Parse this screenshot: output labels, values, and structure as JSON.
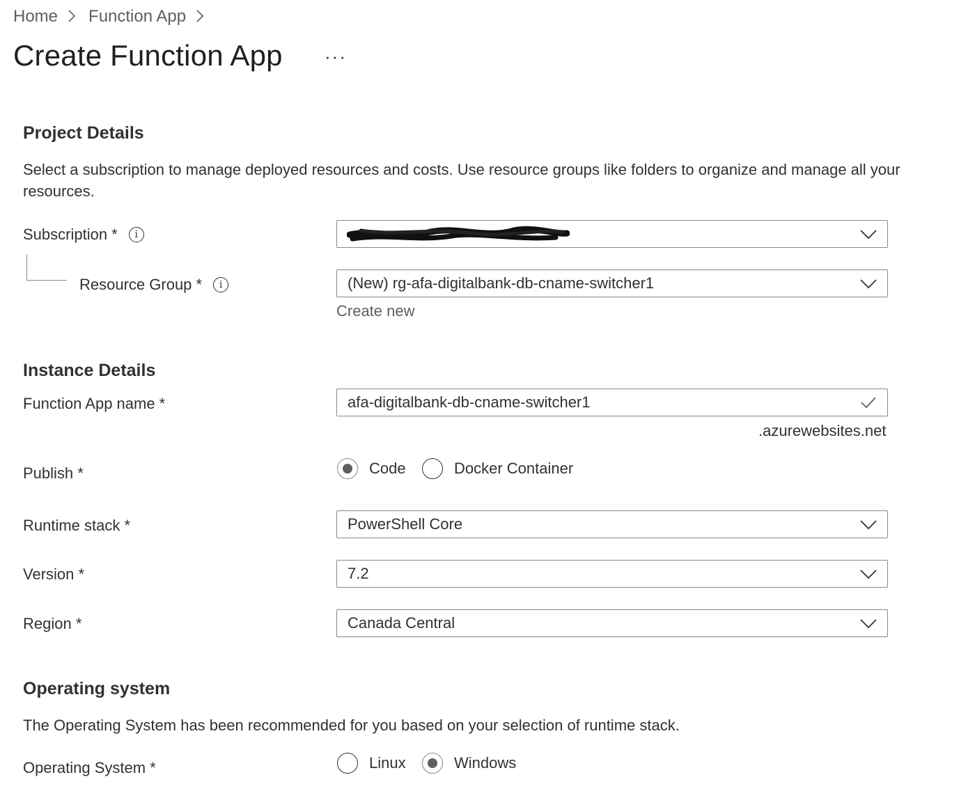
{
  "breadcrumb": {
    "home": "Home",
    "function_app": "Function App",
    "sep": ">"
  },
  "page_title": "Create Function App",
  "more_label": "···",
  "project_details": {
    "heading": "Project Details",
    "description": "Select a subscription to manage deployed resources and costs. Use resource groups like folders to organize and manage all your resources.",
    "subscription_label": "Subscription *",
    "subscription_value": "",
    "resource_group_label": "Resource Group *",
    "resource_group_value": "(New) rg-afa-digitalbank-db-cname-switcher1",
    "create_new": "Create new"
  },
  "instance_details": {
    "heading": "Instance Details",
    "name_label": "Function App name *",
    "name_value": "afa-digitalbank-db-cname-switcher1",
    "name_suffix": ".azurewebsites.net",
    "publish_label": "Publish *",
    "publish_options": [
      "Code",
      "Docker Container"
    ],
    "publish_selected": "Code",
    "runtime_label": "Runtime stack *",
    "runtime_value": "PowerShell Core",
    "version_label": "Version *",
    "version_value": "7.2",
    "region_label": "Region *",
    "region_value": "Canada Central"
  },
  "operating_system": {
    "heading": "Operating system",
    "description": "The Operating System has been recommended for you based on your selection of runtime stack.",
    "os_label": "Operating System *",
    "os_options": [
      "Linux",
      "Windows"
    ],
    "os_selected": "Windows"
  },
  "icons": {
    "info": "info-icon",
    "chevron": "chevron-down-icon",
    "check": "checkmark-icon"
  },
  "colors": {
    "text": "#323130",
    "muted": "#605e5c",
    "border": "#8a8886"
  }
}
